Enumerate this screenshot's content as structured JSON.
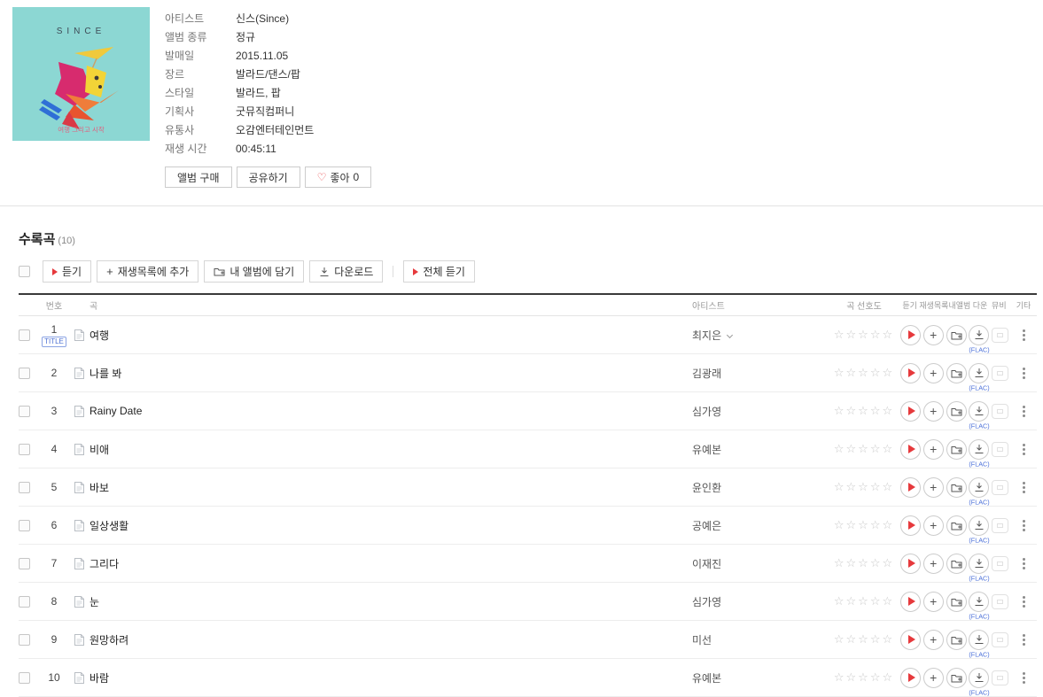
{
  "album": {
    "cover": {
      "brand": "SINCE",
      "caption": "여행 그리고 시작",
      "bg_color": "#8CD7D3"
    },
    "info": [
      {
        "label": "아티스트",
        "value": "신스(Since)"
      },
      {
        "label": "앨범 종류",
        "value": "정규"
      },
      {
        "label": "발매일",
        "value": "2015.11.05"
      },
      {
        "label": "장르",
        "value": "발라드/댄스/팝"
      },
      {
        "label": "스타일",
        "value": "발라드, 팝"
      },
      {
        "label": "기획사",
        "value": "굿뮤직컴퍼니"
      },
      {
        "label": "유통사",
        "value": "오감엔터테인먼트"
      },
      {
        "label": "재생 시간",
        "value": "00:45:11"
      }
    ],
    "actions": {
      "buy": "앨범 구매",
      "share": "공유하기",
      "like": "좋아",
      "like_count": "0"
    }
  },
  "tracklist": {
    "section_title": "수록곡",
    "count": "(10)",
    "toolbar": {
      "listen": "듣기",
      "add_to_playlist": "재생목록에 추가",
      "add_to_my_album": "내 앨범에 담기",
      "download": "다운로드",
      "listen_all": "전체 듣기"
    },
    "columns": {
      "number": "번호",
      "song": "곡",
      "artist": "아티스트",
      "rating": "곡 선호도",
      "listen": "듣기",
      "playlist": "재생목록",
      "myalbum": "내앨범",
      "down": "다운",
      "mv": "뮤비",
      "etc": "기타"
    },
    "stars_empty": "☆☆☆☆☆",
    "flac_label": "(FLAC)",
    "title_badge": "TITLE",
    "tracks": [
      {
        "no": "1",
        "title": "여행",
        "artist": "최지은",
        "is_title": true,
        "expand": true
      },
      {
        "no": "2",
        "title": "나를 봐",
        "artist": "김광래"
      },
      {
        "no": "3",
        "title": "Rainy Date",
        "artist": "심가영"
      },
      {
        "no": "4",
        "title": "비애",
        "artist": "유예본"
      },
      {
        "no": "5",
        "title": "바보",
        "artist": "윤인환"
      },
      {
        "no": "6",
        "title": "일상생활",
        "artist": "공예은"
      },
      {
        "no": "7",
        "title": "그리다",
        "artist": "이재진"
      },
      {
        "no": "8",
        "title": "눈",
        "artist": "심가영"
      },
      {
        "no": "9",
        "title": "원망하려",
        "artist": "미선"
      },
      {
        "no": "10",
        "title": "바람",
        "artist": "유예본"
      }
    ]
  }
}
